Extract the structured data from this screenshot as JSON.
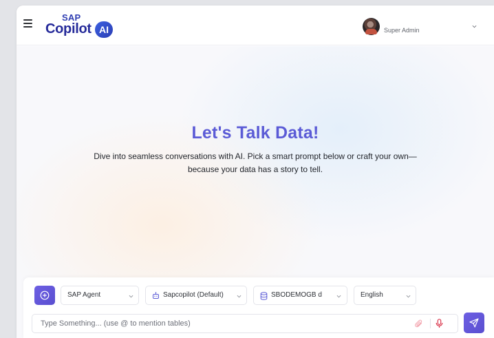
{
  "header": {
    "logo_sap": "SAP",
    "logo_copilot": "Copilot",
    "logo_ai": "AI",
    "user_name": "Super Admin"
  },
  "hero": {
    "title": "Let's Talk Data!",
    "subtitle": "Dive into seamless conversations with AI. Pick a smart prompt below or craft your own— because your data has a story to tell."
  },
  "composer": {
    "agent_select": "SAP Agent",
    "model_select": "Sapcopilot (Default)",
    "database_select": "SBODEMOGB d",
    "language_select": "English",
    "input_placeholder": "Type Something... (use @ to mention tables)",
    "input_value": ""
  },
  "colors": {
    "accent": "#5b5bd6",
    "brand_dark": "#262b9a",
    "mic": "#d9334a",
    "clip": "#f3a6b0"
  },
  "icons": {
    "menu": "hamburger-menu-icon",
    "user_dropdown": "chevron-down-icon",
    "add": "plus-circle-icon",
    "bot": "bot-icon",
    "database": "database-icon",
    "attach": "paperclip-icon",
    "mic": "microphone-icon",
    "send": "send-icon"
  }
}
